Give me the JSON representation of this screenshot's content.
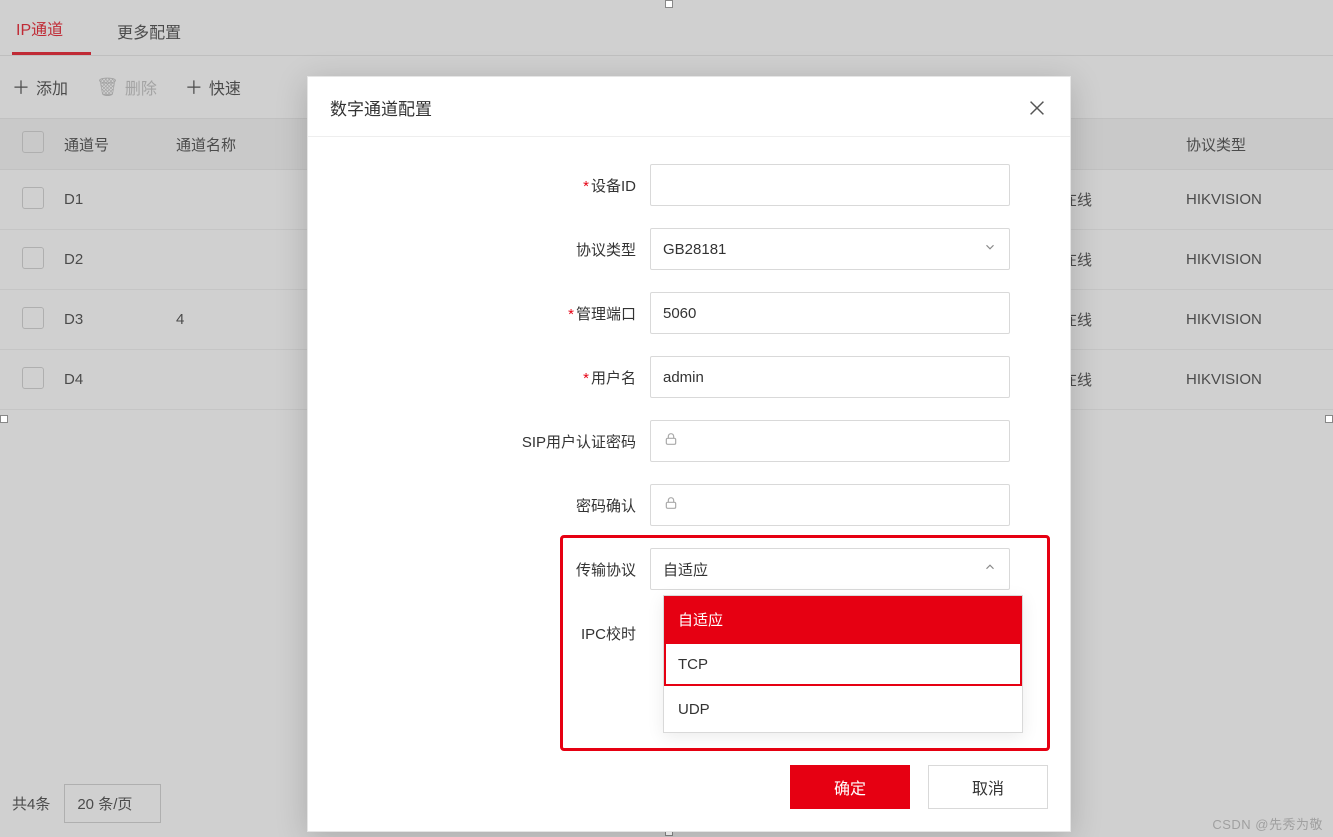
{
  "tabs": {
    "ip_channel": "IP通道",
    "more_config": "更多配置"
  },
  "toolbar": {
    "add": "添加",
    "delete": "删除",
    "quick": "快速"
  },
  "columns": {
    "channel_no": "通道号",
    "channel_name": "通道名称",
    "status": "态",
    "protocol": "协议类型"
  },
  "rows": [
    {
      "ch": "D1",
      "name": " ",
      "status": "在线",
      "protocol": "HIKVISION"
    },
    {
      "ch": "D2",
      "name": " ",
      "status": "在线",
      "protocol": "HIKVISION"
    },
    {
      "ch": "D3",
      "name": "4",
      "status": "在线",
      "protocol": "HIKVISION"
    },
    {
      "ch": "D4",
      "name": " ",
      "status": "在线",
      "protocol": "HIKVISION"
    }
  ],
  "footer": {
    "total": "共4条",
    "page_size": "20 条/页"
  },
  "modal": {
    "title": "数字通道配置",
    "labels": {
      "device_id": "设备ID",
      "protocol": "协议类型",
      "port": "管理端口",
      "username": "用户名",
      "sip_password": "SIP用户认证密码",
      "password_confirm": "密码确认",
      "transport": "传输协议",
      "ipc_time": "IPC校时"
    },
    "values": {
      "device_id": "",
      "protocol": "GB28181",
      "port": "5060",
      "username": "admin",
      "transport": "自适应"
    },
    "transport_options": [
      "自适应",
      "TCP",
      "UDP"
    ],
    "ok": "确定",
    "cancel": "取消"
  },
  "watermark": "CSDN @先秀为敬"
}
